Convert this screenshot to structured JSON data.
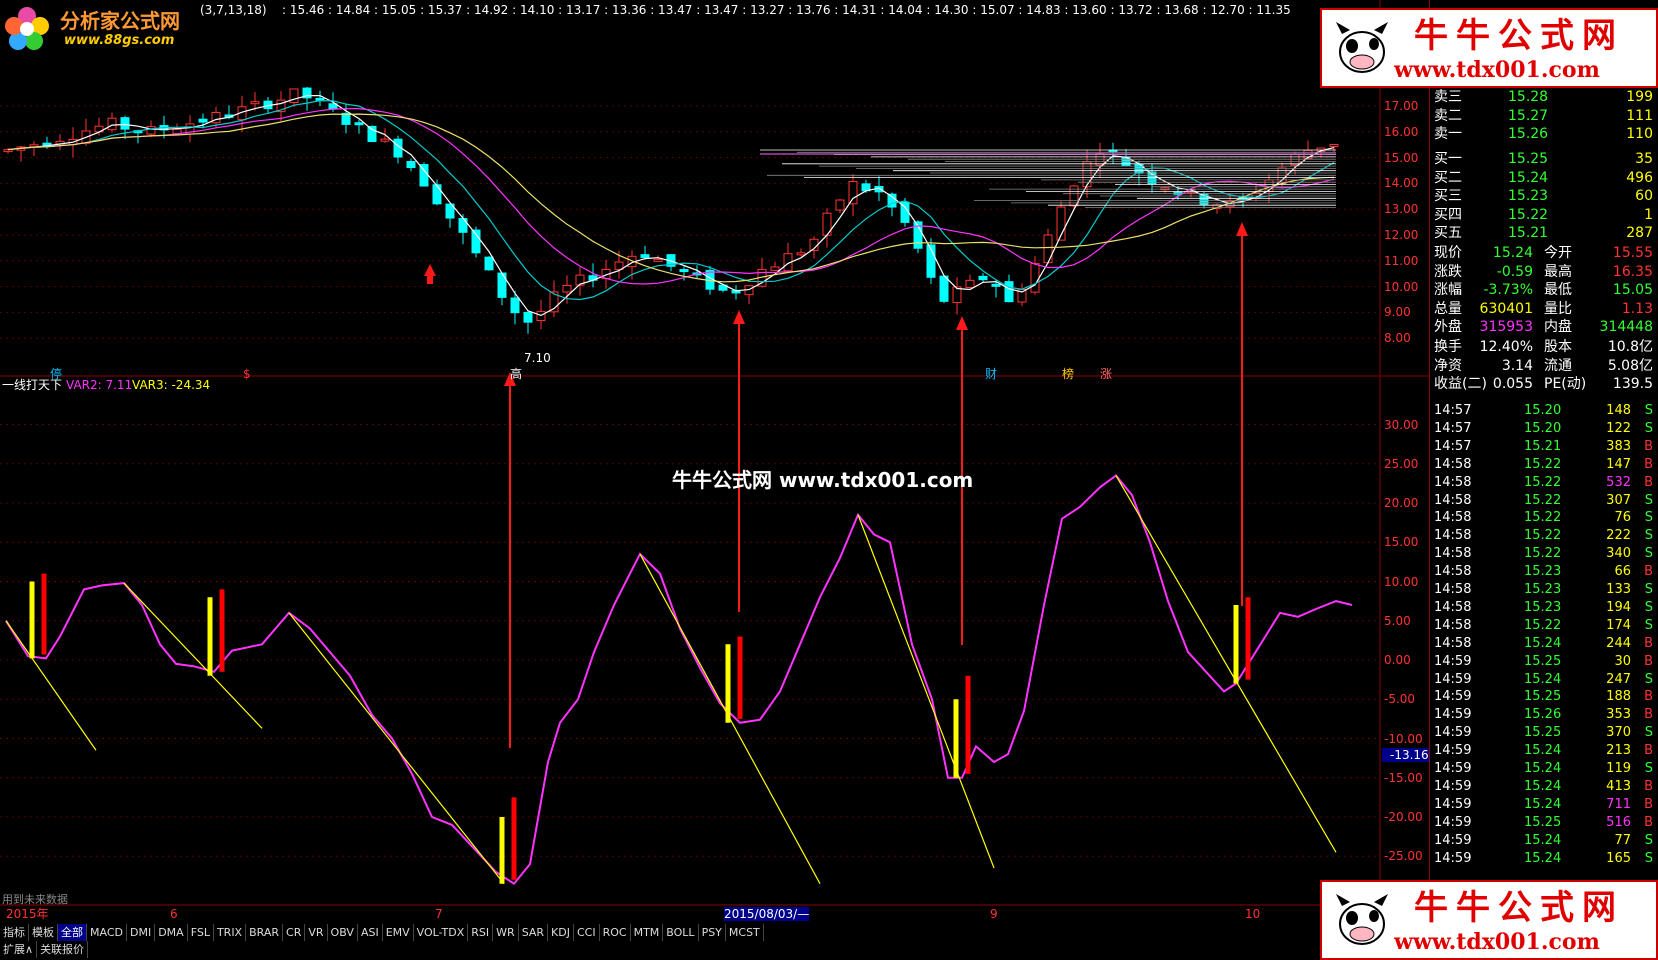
{
  "window": {
    "logo_text": "分析家公式网",
    "logo_url": "www.88gs.com",
    "ma_label": "(3,7,13,18)",
    "price_strip": [
      "15.46",
      "14.84",
      "15.05",
      "15.37",
      "14.92",
      "14.10",
      "13.17",
      "13.36",
      "13.47",
      "13.47",
      "13.27",
      "13.76",
      "14.31",
      "14.04",
      "14.30",
      "15.07",
      "14.83",
      "13.60",
      "13.72",
      "13.68",
      "12.70",
      "11.35"
    ]
  },
  "main_chart": {
    "y_ticks": [
      "17.00",
      "16.00",
      "15.00",
      "14.00",
      "13.00",
      "12.00",
      "11.00",
      "10.00",
      "9.00",
      "8.00"
    ],
    "low_label": "7.10",
    "markers": [
      {
        "text": "停",
        "color": "#00bfff"
      },
      {
        "text": "$",
        "color": "#ff3333"
      },
      {
        "text": "高",
        "color": "#ffffff"
      },
      {
        "text": "财",
        "color": "#00bfff"
      },
      {
        "text": "榜",
        "color": "#ffcc00"
      },
      {
        "text": "涨",
        "color": "#ff6666"
      }
    ]
  },
  "indicator": {
    "name": "一线打天下",
    "var2_label": "VAR2: 7.11",
    "var3_label": "VAR3: -24.34",
    "y_ticks": [
      "30.00",
      "25.00",
      "20.00",
      "15.00",
      "10.00",
      "5.00",
      "0.00",
      "-5.00",
      "-10.00",
      "-15.00",
      "-20.00",
      "-25.00"
    ],
    "current_value": "-13.16",
    "footnote": "用到未来数据",
    "watermark": "牛牛公式网 www.tdx001.com",
    "colors": {
      "line": "#ff33ff",
      "trend": "#ffff00",
      "bar_yellow": "#ffff00",
      "bar_red": "#ff0000"
    }
  },
  "time_axis": {
    "labels": [
      "2015年",
      "6",
      "7",
      "2015/08/03/—",
      "9",
      "10"
    ]
  },
  "toolbar": {
    "tabs": [
      "指标",
      "模板",
      "全部",
      "MACD",
      "DMI",
      "DMA",
      "FSL",
      "TRIX",
      "BRAR",
      "CR",
      "VR",
      "OBV",
      "ASI",
      "EMV",
      "VOL-TDX",
      "RSI",
      "WR",
      "SAR",
      "KDJ",
      "CCI",
      "ROC",
      "MTM",
      "BOLL",
      "PSY",
      "MCST"
    ],
    "bottom": [
      "扩展∧",
      "关联报价"
    ]
  },
  "quote_panel": {
    "asks": [
      {
        "label": "卖三",
        "price": "15.28",
        "vol": "199"
      },
      {
        "label": "卖二",
        "price": "15.27",
        "vol": "111"
      },
      {
        "label": "卖一",
        "price": "15.26",
        "vol": "110"
      }
    ],
    "bids": [
      {
        "label": "买一",
        "price": "15.25",
        "vol": "35"
      },
      {
        "label": "买二",
        "price": "15.24",
        "vol": "496"
      },
      {
        "label": "买三",
        "price": "15.23",
        "vol": "60"
      },
      {
        "label": "买四",
        "price": "15.22",
        "vol": "1"
      },
      {
        "label": "买五",
        "price": "15.21",
        "vol": "287"
      }
    ],
    "stats": [
      {
        "l1": "现价",
        "v1": "15.24",
        "l2": "今开",
        "v2": "15.55"
      },
      {
        "l1": "涨跌",
        "v1": "-0.59",
        "l2": "最高",
        "v2": "16.35"
      },
      {
        "l1": "涨幅",
        "v1": "-3.73%",
        "l2": "最低",
        "v2": "15.05"
      },
      {
        "l1": "总量",
        "v1": "630401",
        "l2": "量比",
        "v2": "1.13"
      },
      {
        "l1": "外盘",
        "v1": "315953",
        "l2": "内盘",
        "v2": "314448"
      }
    ],
    "stats2": [
      {
        "l1": "换手",
        "v1": "12.40%",
        "l2": "股本",
        "v2": "10.8亿"
      },
      {
        "l1": "净资",
        "v1": "3.14",
        "l2": "流通",
        "v2": "5.08亿"
      },
      {
        "l1": "收益(二)",
        "v1": "0.055",
        "l2": "PE(动)",
        "v2": "139.5"
      }
    ],
    "ticks": [
      [
        "14:57",
        "15.20",
        "148",
        "S"
      ],
      [
        "14:57",
        "15.20",
        "122",
        "S"
      ],
      [
        "14:57",
        "15.21",
        "383",
        "B"
      ],
      [
        "14:58",
        "15.22",
        "147",
        "B"
      ],
      [
        "14:58",
        "15.22",
        "532",
        "B"
      ],
      [
        "14:58",
        "15.22",
        "307",
        "S"
      ],
      [
        "14:58",
        "15.22",
        "76",
        "S"
      ],
      [
        "14:58",
        "15.22",
        "222",
        "S"
      ],
      [
        "14:58",
        "15.22",
        "340",
        "S"
      ],
      [
        "14:58",
        "15.23",
        "66",
        "B"
      ],
      [
        "14:58",
        "15.23",
        "133",
        "S"
      ],
      [
        "14:58",
        "15.23",
        "194",
        "S"
      ],
      [
        "14:58",
        "15.22",
        "174",
        "S"
      ],
      [
        "14:58",
        "15.24",
        "244",
        "B"
      ],
      [
        "14:59",
        "15.25",
        "30",
        "B"
      ],
      [
        "14:59",
        "15.24",
        "247",
        "S"
      ],
      [
        "14:59",
        "15.25",
        "188",
        "B"
      ],
      [
        "14:59",
        "15.26",
        "353",
        "B"
      ],
      [
        "14:59",
        "15.25",
        "370",
        "S"
      ],
      [
        "14:59",
        "15.24",
        "213",
        "B"
      ],
      [
        "14:59",
        "15.24",
        "119",
        "S"
      ],
      [
        "14:59",
        "15.24",
        "413",
        "B"
      ],
      [
        "14:59",
        "15.24",
        "711",
        "B"
      ],
      [
        "14:59",
        "15.25",
        "516",
        "B"
      ],
      [
        "14:59",
        "15.24",
        "77",
        "S"
      ],
      [
        "14:59",
        "15.24",
        "165",
        "S"
      ]
    ]
  },
  "ads": [
    {
      "title": "牛牛公式网",
      "url": "www.tdx001.com"
    },
    {
      "title": "牛牛公式网",
      "url": "www.tdx001.com"
    }
  ]
}
